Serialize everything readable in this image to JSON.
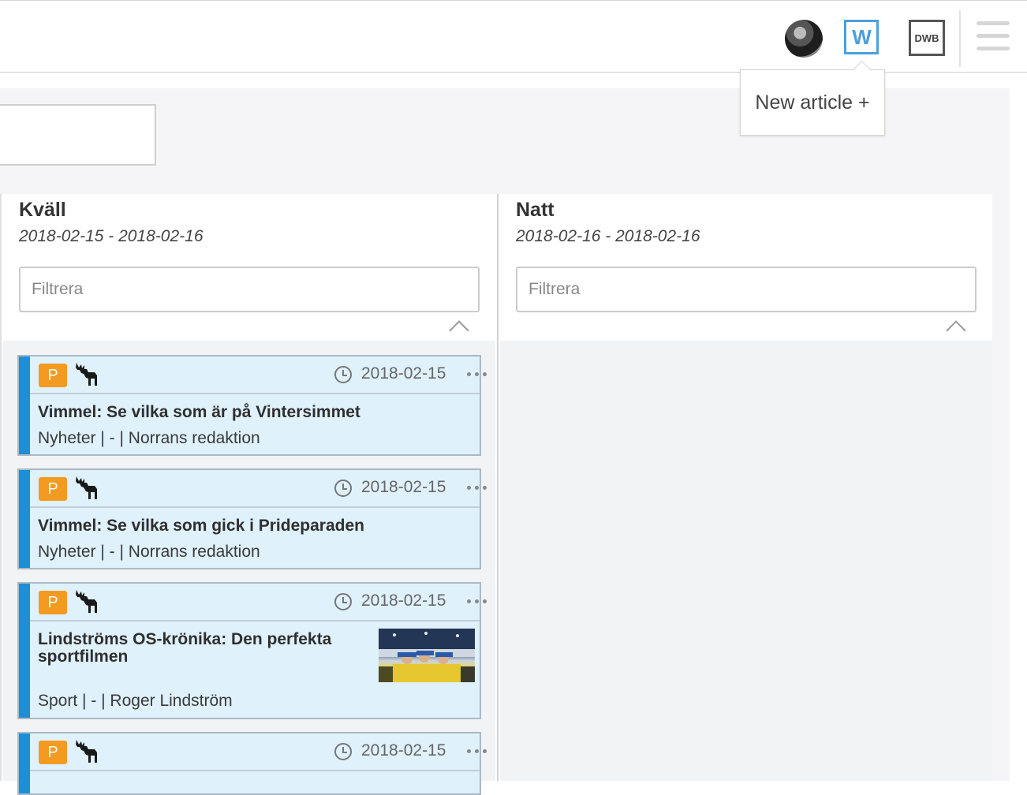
{
  "topbar": {
    "w_label": "W",
    "dwb_label": "DWB"
  },
  "popover": {
    "label": "New article +"
  },
  "columns": [
    {
      "title": "Kväll",
      "dates": "2018-02-15 - 2018-02-16",
      "filter_placeholder": "Filtrera",
      "cards": [
        {
          "badge": "P",
          "date": "2018-02-15",
          "title": "Vimmel: Se vilka som är på Vintersimmet",
          "meta": "Nyheter | - | Norrans redaktion",
          "has_image": false
        },
        {
          "badge": "P",
          "date": "2018-02-15",
          "title": "Vimmel: Se vilka som gick i Prideparaden",
          "meta": "Nyheter | - | Norrans redaktion",
          "has_image": false
        },
        {
          "badge": "P",
          "date": "2018-02-15",
          "title_line1": "Lindströms OS-krönika: Den perfekta",
          "title_line2": "sportfilmen",
          "meta": "Sport | - | Roger Lindström",
          "has_image": true
        },
        {
          "badge": "P",
          "date": "2018-02-15"
        }
      ]
    },
    {
      "title": "Natt",
      "dates": "2018-02-16 - 2018-02-16",
      "filter_placeholder": "Filtrera",
      "cards": []
    }
  ],
  "colors": {
    "accent_blue": "#1e8fd6",
    "card_bg": "#dff1fb",
    "badge_orange": "#f39a21",
    "w_blue": "#4a9fe0"
  }
}
